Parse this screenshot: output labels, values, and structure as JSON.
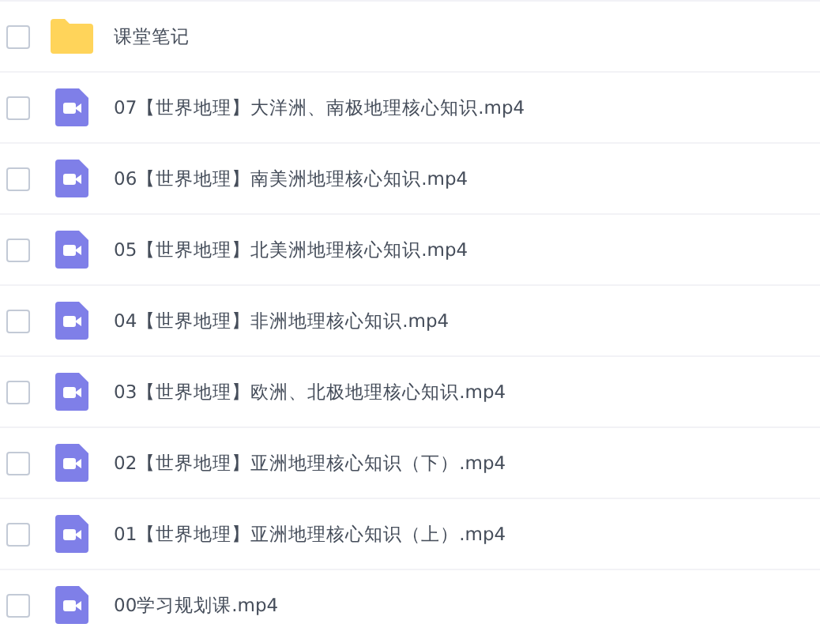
{
  "files": [
    {
      "kind": "folder",
      "name": "课堂笔记",
      "checked": false
    },
    {
      "kind": "video",
      "name": "07【世界地理】大洋洲、南极地理核心知识.mp4",
      "checked": false
    },
    {
      "kind": "video",
      "name": "06【世界地理】南美洲地理核心知识.mp4",
      "checked": false
    },
    {
      "kind": "video",
      "name": "05【世界地理】北美洲地理核心知识.mp4",
      "checked": false
    },
    {
      "kind": "video",
      "name": "04【世界地理】非洲地理核心知识.mp4",
      "checked": false
    },
    {
      "kind": "video",
      "name": "03【世界地理】欧洲、北极地理核心知识.mp4",
      "checked": false
    },
    {
      "kind": "video",
      "name": "02【世界地理】亚洲地理核心知识（下）.mp4",
      "checked": false
    },
    {
      "kind": "video",
      "name": "01【世界地理】亚洲地理核心知识（上）.mp4",
      "checked": false
    },
    {
      "kind": "video",
      "name": "00学习规划课.mp4",
      "checked": false
    }
  ]
}
